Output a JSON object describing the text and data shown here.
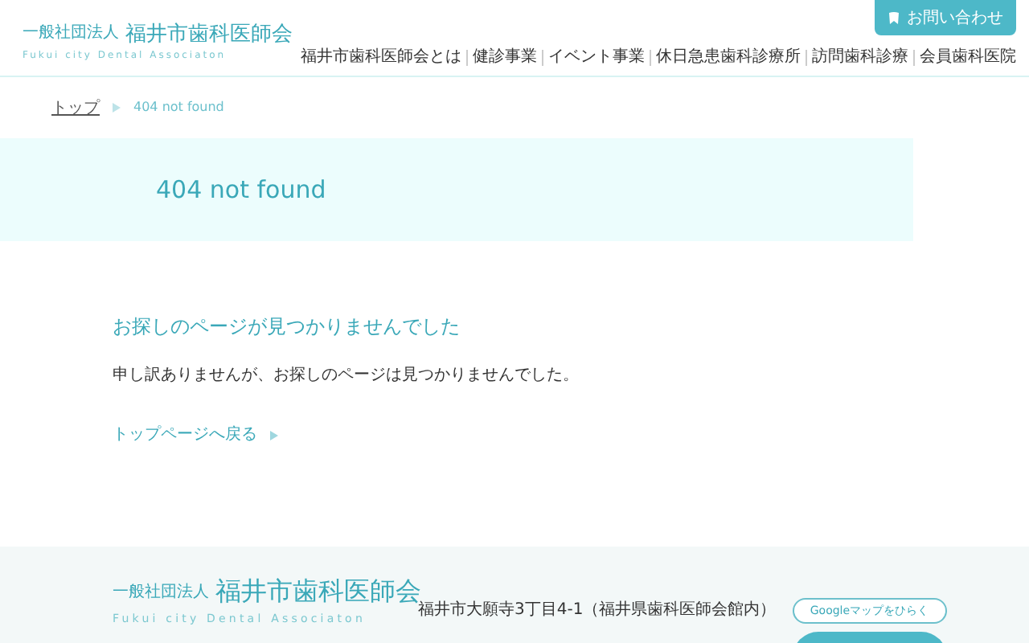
{
  "header": {
    "logo": {
      "prefix": "一般社団法人",
      "name": "福井市歯科医師会",
      "english": "Fukui city Dental Associaton"
    },
    "contact_button": "お問い合わせ",
    "nav": [
      "福井市歯科医師会とは",
      "健診事業",
      "イベント事業",
      "休日急患歯科診療所",
      "訪問歯科診療",
      "会員歯科医院"
    ]
  },
  "breadcrumb": [
    {
      "label": "トップ",
      "kind": "link"
    },
    {
      "label": "404 not found",
      "kind": "current"
    }
  ],
  "hero": {
    "title": "404 not found"
  },
  "content": {
    "heading": "お探しのページが見つかりませんでした",
    "message": "申し訳ありませんが、お探しのページは見つかりませんでした。",
    "back_link": "トップページへ戻る"
  },
  "footer": {
    "logo": {
      "prefix": "一般社団法人",
      "name": "福井市歯科医師会",
      "english": "Fukui city Dental Associaton"
    },
    "address": "福井市大願寺3丁目4-1（福井県歯科医師会館内）",
    "map_button": "Googleマップをひらく"
  }
}
